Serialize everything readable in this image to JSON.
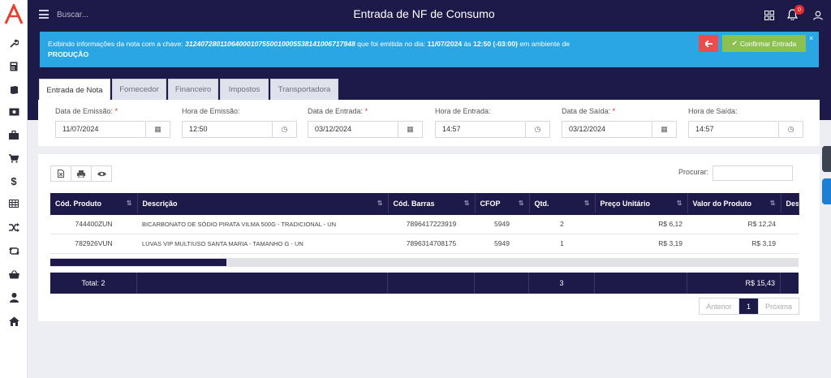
{
  "topbar": {
    "search_placeholder": "Buscar...",
    "title": "Entrada de NF de Consumo",
    "notification_count": "0"
  },
  "sidebar": {
    "items": [
      "wrench-icon",
      "calculator-icon",
      "book-icon",
      "money-icon",
      "briefcase-icon",
      "cart-icon",
      "dollar-icon",
      "table-icon",
      "shuffle-icon",
      "retweet-icon",
      "basket-icon",
      "user-icon",
      "home-icon"
    ]
  },
  "alert": {
    "prefix": "Exibindo informações da nota com a chave: ",
    "key": "31240728011064000107550010005538141006717948",
    "middle1": " que foi emitida no dia: ",
    "date": "11/07/2024",
    "middle2": " às ",
    "time": "12:50 (-03:00)",
    "middle3": " em ambiente de ",
    "environment": "PRODUÇÃO",
    "confirm_label": "Confirmar Entrada",
    "close": "×"
  },
  "tabs": [
    "Entrada de Nota",
    "Fornecedor",
    "Financeiro",
    "Impostos",
    "Transportadora"
  ],
  "dates": [
    {
      "label": "Data de Emissão:",
      "required": true,
      "value": "11/07/2024",
      "icon": "calendar-icon"
    },
    {
      "label": "Hora de Emissão:",
      "required": false,
      "value": "12:50",
      "icon": "clock-icon"
    },
    {
      "label": "Data de Entrada:",
      "required": true,
      "value": "03/12/2024",
      "icon": "calendar-icon"
    },
    {
      "label": "Hora de Entrada:",
      "required": false,
      "value": "14:57",
      "icon": "clock-icon"
    },
    {
      "label": "Data de Saída:",
      "required": true,
      "value": "03/12/2024",
      "icon": "calendar-icon"
    },
    {
      "label": "Hora de Saída:",
      "required": false,
      "value": "14:57",
      "icon": "clock-icon"
    }
  ],
  "products": {
    "search_label": "Procurar:",
    "columns": [
      "Cód. Produto",
      "Descrição",
      "Cód. Barras",
      "CFOP",
      "Qtd.",
      "Preço Unitário",
      "Valor do Produto",
      "Des"
    ],
    "rows": [
      {
        "code": "744400ZUN",
        "desc": "BICARBONATO DE SÓDIO PIRATA VILMA 500G - TRADICIONAL - UN",
        "barcode": "7896417223919",
        "cfop": "5949",
        "qty": "2",
        "unit": "R$ 6,12",
        "total": "R$ 12,24"
      },
      {
        "code": "782926VUN",
        "desc": "LUVAS VIP MULTIUSO SANTA MARIA - TAMANHO G - UN",
        "barcode": "7896314708175",
        "cfop": "5949",
        "qty": "1",
        "unit": "R$ 3,19",
        "total": "R$ 3,19"
      }
    ],
    "totals": {
      "label": "Total: 2",
      "qty": "3",
      "value": "R$ 15,43"
    }
  },
  "pager": {
    "prev": "Anterior",
    "current": "1",
    "next": "Próxima"
  },
  "colors": {
    "navy": "#1d1a4a",
    "info": "#2aa6e4",
    "danger": "#ec4c4b",
    "success": "#8cc152"
  }
}
